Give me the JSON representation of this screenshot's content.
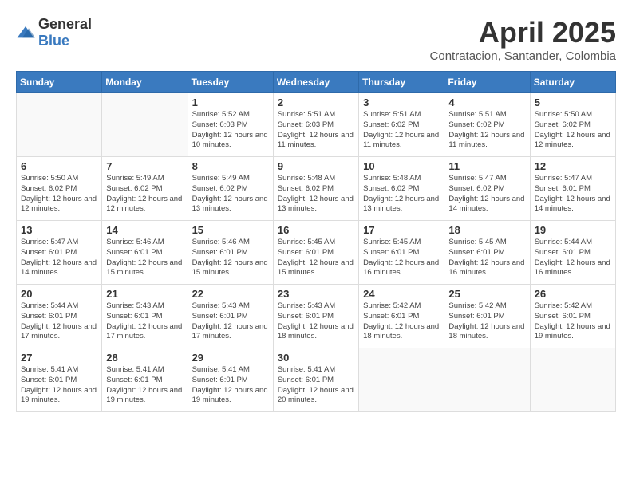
{
  "header": {
    "logo": {
      "general": "General",
      "blue": "Blue"
    },
    "title": "April 2025",
    "location": "Contratacion, Santander, Colombia"
  },
  "weekdays": [
    "Sunday",
    "Monday",
    "Tuesday",
    "Wednesday",
    "Thursday",
    "Friday",
    "Saturday"
  ],
  "weeks": [
    [
      {
        "day": "",
        "empty": true
      },
      {
        "day": "",
        "empty": true
      },
      {
        "day": "1",
        "sunrise": "Sunrise: 5:52 AM",
        "sunset": "Sunset: 6:03 PM",
        "daylight": "Daylight: 12 hours and 10 minutes."
      },
      {
        "day": "2",
        "sunrise": "Sunrise: 5:51 AM",
        "sunset": "Sunset: 6:03 PM",
        "daylight": "Daylight: 12 hours and 11 minutes."
      },
      {
        "day": "3",
        "sunrise": "Sunrise: 5:51 AM",
        "sunset": "Sunset: 6:02 PM",
        "daylight": "Daylight: 12 hours and 11 minutes."
      },
      {
        "day": "4",
        "sunrise": "Sunrise: 5:51 AM",
        "sunset": "Sunset: 6:02 PM",
        "daylight": "Daylight: 12 hours and 11 minutes."
      },
      {
        "day": "5",
        "sunrise": "Sunrise: 5:50 AM",
        "sunset": "Sunset: 6:02 PM",
        "daylight": "Daylight: 12 hours and 12 minutes."
      }
    ],
    [
      {
        "day": "6",
        "sunrise": "Sunrise: 5:50 AM",
        "sunset": "Sunset: 6:02 PM",
        "daylight": "Daylight: 12 hours and 12 minutes."
      },
      {
        "day": "7",
        "sunrise": "Sunrise: 5:49 AM",
        "sunset": "Sunset: 6:02 PM",
        "daylight": "Daylight: 12 hours and 12 minutes."
      },
      {
        "day": "8",
        "sunrise": "Sunrise: 5:49 AM",
        "sunset": "Sunset: 6:02 PM",
        "daylight": "Daylight: 12 hours and 13 minutes."
      },
      {
        "day": "9",
        "sunrise": "Sunrise: 5:48 AM",
        "sunset": "Sunset: 6:02 PM",
        "daylight": "Daylight: 12 hours and 13 minutes."
      },
      {
        "day": "10",
        "sunrise": "Sunrise: 5:48 AM",
        "sunset": "Sunset: 6:02 PM",
        "daylight": "Daylight: 12 hours and 13 minutes."
      },
      {
        "day": "11",
        "sunrise": "Sunrise: 5:47 AM",
        "sunset": "Sunset: 6:02 PM",
        "daylight": "Daylight: 12 hours and 14 minutes."
      },
      {
        "day": "12",
        "sunrise": "Sunrise: 5:47 AM",
        "sunset": "Sunset: 6:01 PM",
        "daylight": "Daylight: 12 hours and 14 minutes."
      }
    ],
    [
      {
        "day": "13",
        "sunrise": "Sunrise: 5:47 AM",
        "sunset": "Sunset: 6:01 PM",
        "daylight": "Daylight: 12 hours and 14 minutes."
      },
      {
        "day": "14",
        "sunrise": "Sunrise: 5:46 AM",
        "sunset": "Sunset: 6:01 PM",
        "daylight": "Daylight: 12 hours and 15 minutes."
      },
      {
        "day": "15",
        "sunrise": "Sunrise: 5:46 AM",
        "sunset": "Sunset: 6:01 PM",
        "daylight": "Daylight: 12 hours and 15 minutes."
      },
      {
        "day": "16",
        "sunrise": "Sunrise: 5:45 AM",
        "sunset": "Sunset: 6:01 PM",
        "daylight": "Daylight: 12 hours and 15 minutes."
      },
      {
        "day": "17",
        "sunrise": "Sunrise: 5:45 AM",
        "sunset": "Sunset: 6:01 PM",
        "daylight": "Daylight: 12 hours and 16 minutes."
      },
      {
        "day": "18",
        "sunrise": "Sunrise: 5:45 AM",
        "sunset": "Sunset: 6:01 PM",
        "daylight": "Daylight: 12 hours and 16 minutes."
      },
      {
        "day": "19",
        "sunrise": "Sunrise: 5:44 AM",
        "sunset": "Sunset: 6:01 PM",
        "daylight": "Daylight: 12 hours and 16 minutes."
      }
    ],
    [
      {
        "day": "20",
        "sunrise": "Sunrise: 5:44 AM",
        "sunset": "Sunset: 6:01 PM",
        "daylight": "Daylight: 12 hours and 17 minutes."
      },
      {
        "day": "21",
        "sunrise": "Sunrise: 5:43 AM",
        "sunset": "Sunset: 6:01 PM",
        "daylight": "Daylight: 12 hours and 17 minutes."
      },
      {
        "day": "22",
        "sunrise": "Sunrise: 5:43 AM",
        "sunset": "Sunset: 6:01 PM",
        "daylight": "Daylight: 12 hours and 17 minutes."
      },
      {
        "day": "23",
        "sunrise": "Sunrise: 5:43 AM",
        "sunset": "Sunset: 6:01 PM",
        "daylight": "Daylight: 12 hours and 18 minutes."
      },
      {
        "day": "24",
        "sunrise": "Sunrise: 5:42 AM",
        "sunset": "Sunset: 6:01 PM",
        "daylight": "Daylight: 12 hours and 18 minutes."
      },
      {
        "day": "25",
        "sunrise": "Sunrise: 5:42 AM",
        "sunset": "Sunset: 6:01 PM",
        "daylight": "Daylight: 12 hours and 18 minutes."
      },
      {
        "day": "26",
        "sunrise": "Sunrise: 5:42 AM",
        "sunset": "Sunset: 6:01 PM",
        "daylight": "Daylight: 12 hours and 19 minutes."
      }
    ],
    [
      {
        "day": "27",
        "sunrise": "Sunrise: 5:41 AM",
        "sunset": "Sunset: 6:01 PM",
        "daylight": "Daylight: 12 hours and 19 minutes."
      },
      {
        "day": "28",
        "sunrise": "Sunrise: 5:41 AM",
        "sunset": "Sunset: 6:01 PM",
        "daylight": "Daylight: 12 hours and 19 minutes."
      },
      {
        "day": "29",
        "sunrise": "Sunrise: 5:41 AM",
        "sunset": "Sunset: 6:01 PM",
        "daylight": "Daylight: 12 hours and 19 minutes."
      },
      {
        "day": "30",
        "sunrise": "Sunrise: 5:41 AM",
        "sunset": "Sunset: 6:01 PM",
        "daylight": "Daylight: 12 hours and 20 minutes."
      },
      {
        "day": "",
        "empty": true
      },
      {
        "day": "",
        "empty": true
      },
      {
        "day": "",
        "empty": true
      }
    ]
  ]
}
